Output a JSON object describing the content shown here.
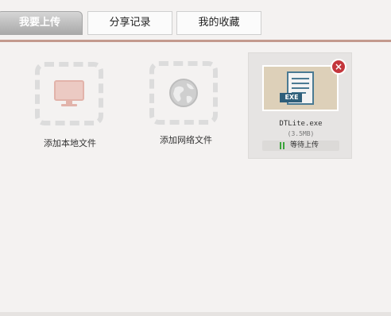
{
  "tabs": [
    {
      "label": "我要上传",
      "active": true
    },
    {
      "label": "分享记录",
      "active": false
    },
    {
      "label": "我的收藏",
      "active": false
    }
  ],
  "add_options": {
    "local": {
      "label": "添加本地文件",
      "icon": "monitor-icon"
    },
    "network": {
      "label": "添加网络文件",
      "icon": "globe-icon"
    }
  },
  "upload_item": {
    "filename": "DTLite.exe",
    "size": "(3.5MB)",
    "status": "等待上传",
    "thumbnail_label": "EXE",
    "status_icon": "pause-icon",
    "close_icon": "close-icon"
  },
  "colors": {
    "accent_line": "#c39a8e",
    "close_button": "#c4363c",
    "status_icon": "#3aa33a",
    "thumbnail_bg": "#ddd0b9"
  }
}
